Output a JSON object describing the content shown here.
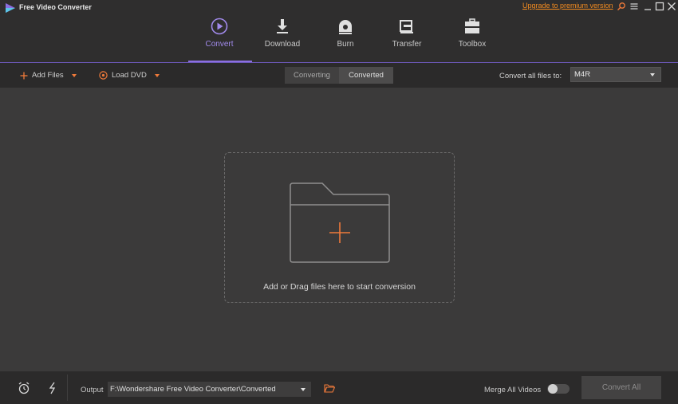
{
  "app": {
    "title": "Free Video Converter",
    "upgrade_link": "Upgrade to premium version",
    "accent_color": "#8c6fe0",
    "orange_color": "#f07a3a"
  },
  "window_controls": [
    {
      "name": "search-icon"
    },
    {
      "name": "menu-icon"
    },
    {
      "name": "minimize-icon"
    },
    {
      "name": "maximize-icon"
    },
    {
      "name": "close-icon"
    }
  ],
  "nav": {
    "active": "Convert",
    "items": [
      {
        "label": "Convert",
        "icon": "convert-icon"
      },
      {
        "label": "Download",
        "icon": "download-icon"
      },
      {
        "label": "Burn",
        "icon": "burn-icon"
      },
      {
        "label": "Transfer",
        "icon": "transfer-icon"
      },
      {
        "label": "Toolbox",
        "icon": "toolbox-icon"
      }
    ]
  },
  "toolbar": {
    "add_files": "Add Files",
    "load_dvd": "Load DVD",
    "tabs": [
      "Converting",
      "Converted"
    ],
    "active_tab": "Converted",
    "convert_all_label": "Convert all files to:",
    "format_value": "M4R"
  },
  "dropzone": {
    "text": "Add or Drag files here to start conversion"
  },
  "bottom": {
    "output_label": "Output",
    "output_path": "F:\\Wondershare Free Video Converter\\Converted",
    "merge_label": "Merge All Videos",
    "merge_on": false,
    "convert_all_button": "Convert All"
  }
}
